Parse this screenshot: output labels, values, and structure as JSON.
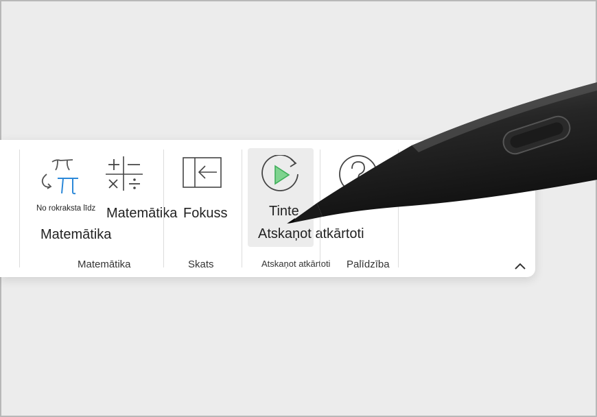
{
  "ribbon": {
    "buttons": {
      "ink_to_math_caption": "No rokraksta līdz",
      "ink_to_math_label": "Matemātika",
      "math_label": "Matemātika",
      "focus_label": "Fokuss",
      "replay_line1": "Tinte",
      "replay_line2": "Atskaņot atkārtoti"
    },
    "groups": {
      "math": "Matemātika",
      "view": "Skats",
      "replay": "Atskaņot atkārtoti",
      "help": "Palīdzība"
    }
  },
  "icons": {
    "ink_to_math": "pi-ink-to-math-icon",
    "math": "math-operators-icon",
    "focus": "focus-panel-icon",
    "replay": "replay-play-icon",
    "help": "help-question-icon",
    "collapse": "chevron-up-icon"
  },
  "colors": {
    "accent_blue": "#2b88d8",
    "play_green": "#3fae5a"
  }
}
